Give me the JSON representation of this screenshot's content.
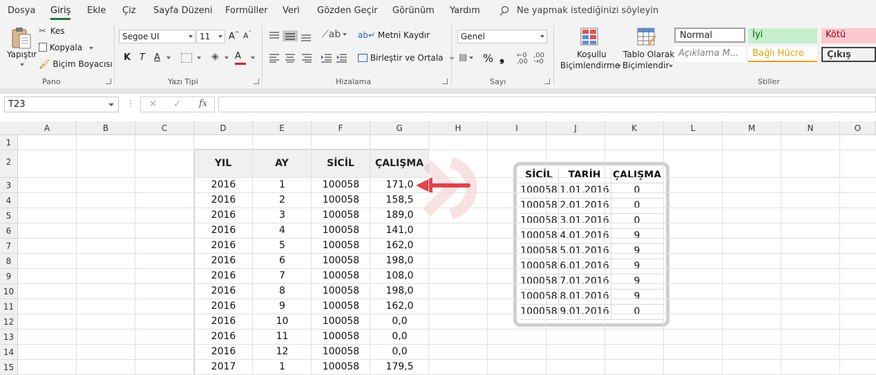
{
  "menu": {
    "items": [
      "Dosya",
      "Giriş",
      "Ekle",
      "Çiz",
      "Sayfa Düzeni",
      "Formüller",
      "Veri",
      "Gözden Geçir",
      "Görünüm",
      "Yardım"
    ],
    "active": "Giriş",
    "tell_me": "Ne yapmak istediğinizi söyleyin"
  },
  "ribbon": {
    "clipboard": {
      "paste": "Yapıştır",
      "cut": "Kes",
      "copy": "Kopyala",
      "format_painter": "Biçim Boyacısı",
      "label": "Pano"
    },
    "font": {
      "family": "Segoe UI",
      "size": "11",
      "bold": "K",
      "italic": "T",
      "underline": "A",
      "label": "Yazı Tipi",
      "font_color": "#e81123"
    },
    "alignment": {
      "wrap_text": "Metni Kaydır",
      "merge_center": "Birleştir ve Ortala",
      "label": "Hizalama"
    },
    "number": {
      "format": "Genel",
      "percent": "%",
      "comma": "❟",
      "label": "Sayı"
    },
    "styles": {
      "conditional_l1": "Koşullu",
      "conditional_l2": "Biçimlendirme",
      "table_l1": "Tablo Olarak",
      "table_l2": "Biçimlendir",
      "normal": "Normal",
      "good": "İyi",
      "bad": "Kötü",
      "explanatory": "Açıklama M...",
      "linked_cell": "Bağlı Hücre",
      "output": "Çıkış",
      "label": "Stiller"
    }
  },
  "formula_bar": {
    "name_box": "T23",
    "fx": "fx",
    "cancel": "✕",
    "enter": "✓",
    "content": ""
  },
  "grid": {
    "columns": [
      "A",
      "B",
      "C",
      "D",
      "E",
      "F",
      "G",
      "H",
      "I",
      "J",
      "K",
      "L",
      "M",
      "N",
      "O"
    ],
    "rows": [
      "1",
      "2",
      "3",
      "4",
      "5",
      "6",
      "7",
      "8",
      "9",
      "10",
      "11",
      "12",
      "13",
      "14",
      "15"
    ]
  },
  "main_table": {
    "headers": [
      "YIL",
      "AY",
      "SİCİL",
      "ÇALIŞMA"
    ],
    "rows": [
      [
        "2016",
        "1",
        "100058",
        "171,0"
      ],
      [
        "2016",
        "2",
        "100058",
        "158,5"
      ],
      [
        "2016",
        "3",
        "100058",
        "189,0"
      ],
      [
        "2016",
        "4",
        "100058",
        "141,0"
      ],
      [
        "2016",
        "5",
        "100058",
        "162,0"
      ],
      [
        "2016",
        "6",
        "100058",
        "198,0"
      ],
      [
        "2016",
        "7",
        "100058",
        "108,0"
      ],
      [
        "2016",
        "8",
        "100058",
        "198,0"
      ],
      [
        "2016",
        "9",
        "100058",
        "162,0"
      ],
      [
        "2016",
        "10",
        "100058",
        "0,0"
      ],
      [
        "2016",
        "11",
        "100058",
        "0,0"
      ],
      [
        "2016",
        "12",
        "100058",
        "0,0"
      ],
      [
        "2017",
        "1",
        "100058",
        "179,5"
      ]
    ]
  },
  "side_table": {
    "headers": [
      "SİCİL",
      "TARİH",
      "ÇALIŞMA"
    ],
    "rows": [
      [
        "100058",
        "1.01.2016",
        "0"
      ],
      [
        "100058",
        "2.01.2016",
        "0"
      ],
      [
        "100058",
        "3.01.2016",
        "0"
      ],
      [
        "100058",
        "4.01.2016",
        "9"
      ],
      [
        "100058",
        "5.01.2016",
        "9"
      ],
      [
        "100058",
        "6.01.2016",
        "9"
      ],
      [
        "100058",
        "7.01.2016",
        "9"
      ],
      [
        "100058",
        "8.01.2016",
        "9"
      ],
      [
        "100058",
        "9.01.2016",
        "0"
      ]
    ]
  },
  "colors": {
    "accent": "#217346",
    "arrow": "#e8424a",
    "good_bg": "#c6efce",
    "bad_bg": "#ffc7ce",
    "linked": "#e4a100"
  }
}
